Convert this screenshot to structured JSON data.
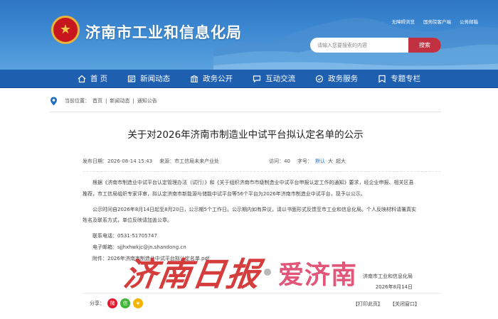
{
  "site": {
    "title": "济南市工业和信息化局",
    "emblem_icon": "national-emblem-icon",
    "top_links": [
      "无障碍浏览",
      "国务院客户端",
      "公务邮箱"
    ]
  },
  "search": {
    "placeholder": "请输入您要搜索的内容",
    "button_label": "搜索"
  },
  "nav": {
    "items": [
      {
        "label": "首 页",
        "icon": "home-icon"
      },
      {
        "label": "新闻动态",
        "icon": "news-icon"
      },
      {
        "label": "政务公开",
        "icon": "building-icon"
      },
      {
        "label": "互动交流",
        "icon": "chat-icon"
      },
      {
        "label": "政务服务",
        "icon": "service-icon"
      },
      {
        "label": "专题专栏",
        "icon": "topic-icon"
      }
    ]
  },
  "breadcrumb": {
    "prefix": "当前位置：",
    "items": [
      "首页",
      "新闻动态",
      "通知公告"
    ],
    "separator": "|"
  },
  "article": {
    "title": "关于对2026年济南市制造业中试平台拟认定名单的公示",
    "meta": {
      "date_label": "发布日期：",
      "date": "2026-08-14 15:43",
      "source_label": "来源：",
      "source": "市工信局未来产业处",
      "views_label": "访问：",
      "views": "40",
      "font_label": "字号：",
      "font_sizes": [
        "默认",
        "大",
        "超大"
      ]
    },
    "paragraphs": [
      "根据《济南市制造业中试平台认定管理办法（试行）》和《关于组织济南市市级制造业中试平台申报认定工作的通知》要求，经企业申报、相关区县推荐，市工信局组织专家评审，拟认定济南市新能源与储能中试平台等56个平台为2026年济南市制造业中试平台，现予以公示。",
      "公示时间自2026年8月14日起至8月20日，公示期5个工作日。公示期内如有异议，请以书面形式反馈至市工业和信息化局。个人反映材料请署真实姓名及联系方式，单位反映请加盖公章。"
    ],
    "contact": {
      "phone_label": "联系电话：",
      "phone": "0531-51705747",
      "email_label": "电子邮箱：",
      "email": "sjjhxhwkjc@jn.shandong.cn",
      "attachment_label": "附件：",
      "attachment": "2026年济南市制造业中试平台拟认定名单.pdf"
    },
    "signature": {
      "org": "济南市工业和信息化局",
      "date": "2026年8月14日"
    }
  },
  "share": {
    "label": "分享：",
    "icons": [
      "weibo-icon",
      "wechat-icon",
      "qzone-icon"
    ]
  },
  "page_actions": {
    "print": "【打印此页】",
    "close": "【关闭窗口】"
  },
  "watermark": {
    "left": "济南日报",
    "right": "爱济南"
  },
  "colors": {
    "header_blue": "#2e76c4",
    "nav_blue": "#1f5fb0",
    "search_button": "#c03040",
    "watermark_red": "#d22c2c",
    "watermark_pink": "#e0486e"
  }
}
